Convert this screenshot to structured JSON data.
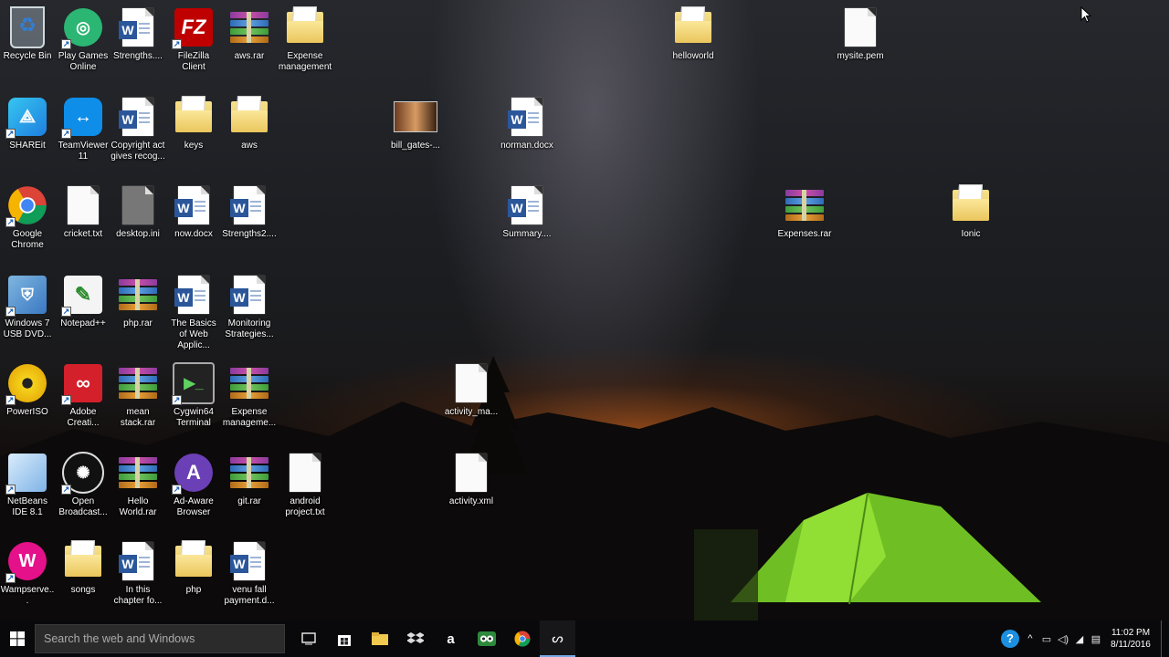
{
  "desktop": {
    "icons": [
      {
        "label": "Recycle Bin",
        "kind": "recycle"
      },
      {
        "label": "Play Games Online",
        "kind": "games"
      },
      {
        "label": "Strengths....",
        "kind": "word"
      },
      {
        "label": "FileZilla Client",
        "kind": "filezilla"
      },
      {
        "label": "aws.rar",
        "kind": "rar"
      },
      {
        "label": "Expense management",
        "kind": "folder"
      },
      {
        "label": "SHAREit",
        "kind": "shareit"
      },
      {
        "label": "TeamViewer 11",
        "kind": "teamviewer"
      },
      {
        "label": "Copyright act gives recog...",
        "kind": "word"
      },
      {
        "label": "keys",
        "kind": "folder"
      },
      {
        "label": "aws",
        "kind": "folder"
      },
      {
        "label": "Google Chrome",
        "kind": "chrome"
      },
      {
        "label": "cricket.txt",
        "kind": "file"
      },
      {
        "label": "desktop.ini",
        "kind": "ini"
      },
      {
        "label": "now.docx",
        "kind": "word"
      },
      {
        "label": "Strengths2....",
        "kind": "word"
      },
      {
        "label": "Windows 7 USB DVD...",
        "kind": "win7usb"
      },
      {
        "label": "Notepad++",
        "kind": "notepadpp"
      },
      {
        "label": "php.rar",
        "kind": "rar"
      },
      {
        "label": "The Basics of Web Applic...",
        "kind": "word"
      },
      {
        "label": "Monitoring Strategies...",
        "kind": "word"
      },
      {
        "label": "PowerISO",
        "kind": "poweriso"
      },
      {
        "label": "Adobe Creati...",
        "kind": "adobe"
      },
      {
        "label": "mean stack.rar",
        "kind": "rar"
      },
      {
        "label": "Cygwin64 Terminal",
        "kind": "cygwin"
      },
      {
        "label": "Expense manageme...",
        "kind": "rar"
      },
      {
        "label": "NetBeans IDE 8.1",
        "kind": "netbeans"
      },
      {
        "label": "Open Broadcast...",
        "kind": "obs"
      },
      {
        "label": "Hello World.rar",
        "kind": "rar"
      },
      {
        "label": "Ad-Aware Browser",
        "kind": "adaware"
      },
      {
        "label": "git.rar",
        "kind": "rar"
      },
      {
        "label": "android project.txt",
        "kind": "file"
      },
      {
        "label": "Wampserve...",
        "kind": "wamp"
      },
      {
        "label": "songs",
        "kind": "songs"
      },
      {
        "label": "In this chapter fo...",
        "kind": "word"
      },
      {
        "label": "php",
        "kind": "folder"
      },
      {
        "label": "venu fall payment.d...",
        "kind": "word"
      },
      {
        "label": "bill_gates-...",
        "kind": "photo"
      },
      {
        "label": "norman.docx",
        "kind": "word"
      },
      {
        "label": "Summary....",
        "kind": "word"
      },
      {
        "label": "activity_ma...",
        "kind": "file"
      },
      {
        "label": "activity.xml",
        "kind": "file"
      },
      {
        "label": "helloworld",
        "kind": "folder"
      },
      {
        "label": "mysite.pem",
        "kind": "file"
      },
      {
        "label": "Expenses.rar",
        "kind": "rar"
      },
      {
        "label": "Ionic",
        "kind": "folder"
      }
    ]
  },
  "taskbar": {
    "search_placeholder": "Search the web and Windows",
    "pinned": [
      "task-view-icon",
      "store-icon",
      "file-explorer-icon",
      "dropbox-icon",
      "amazon-icon",
      "tripadvisor-icon",
      "chrome-icon",
      "obs-icon"
    ],
    "clock_time": "11:02 PM",
    "clock_date": "8/11/2016"
  },
  "colors": {
    "word_blue": "#2b579a",
    "taskbar_bg": "#0a0a0c",
    "tent_green": "#7fd12b"
  }
}
